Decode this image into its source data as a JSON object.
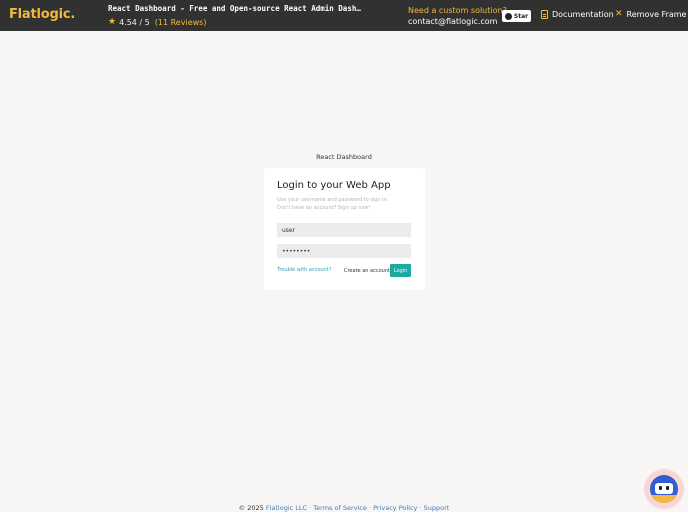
{
  "topbar": {
    "logo": "Flatlogic.",
    "product_title": "React Dashboard - Free and Open-source React Admin Dashboa…",
    "rating": "4.54 / 5",
    "reviews": "(11 Reviews)",
    "need_custom": "Need a custom solution?",
    "contact": "contact@flatlogic.com",
    "star_label": "Star",
    "documentation": "Documentation",
    "remove_frame": "Remove Frame"
  },
  "login": {
    "app_name": "React Dashboard",
    "title": "Login to your Web App",
    "subtitle_line1": "Use your username and password to sign in.",
    "subtitle_line2": "Don't have an account? Sign up now!",
    "username_value": "user",
    "password_value": "••••••••",
    "trouble_link": "Trouble with account?",
    "create_account": "Create an account",
    "login_button": "Login"
  },
  "footer": {
    "copyright": "© 2025",
    "company": "Flatlogic LLC",
    "terms": "Terms of Service",
    "privacy": "Privacy Policy",
    "support": "Support",
    "separator": "·"
  },
  "colors": {
    "accent": "#f2b93b",
    "topbar_bg": "#313131",
    "login_button": "#1ba9a0",
    "link": "#3b9bb5"
  }
}
